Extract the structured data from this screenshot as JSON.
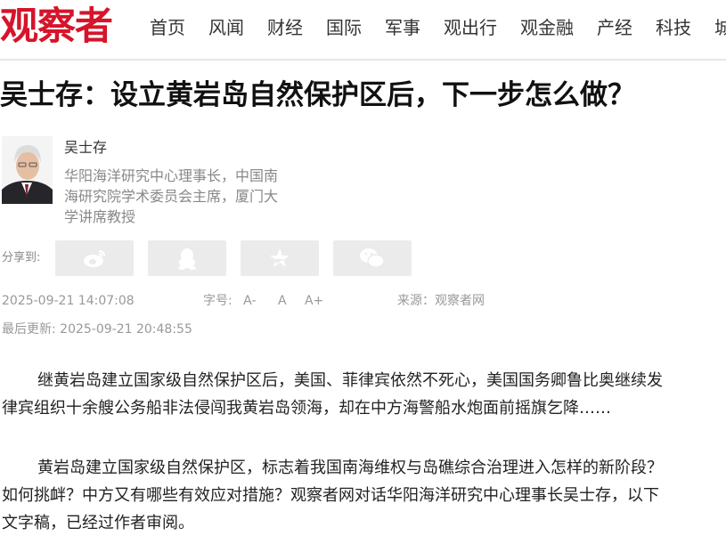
{
  "site": {
    "logo_text": "观察者"
  },
  "nav": [
    "首页",
    "风闻",
    "财经",
    "国际",
    "军事",
    "观出行",
    "观金融",
    "产经",
    "科技",
    "城"
  ],
  "article": {
    "title": "吴士存：设立黄岩岛自然保护区后，下一步怎么做？",
    "author": {
      "name": "吴士存",
      "bio": "华阳海洋研究中心理事长，中国南海研究院学术委员会主席，厦门大学讲席教授"
    },
    "share": {
      "label": "分享到:",
      "buttons": [
        "weibo-icon",
        "qq-icon",
        "qzone-star-icon",
        "wechat-icon"
      ]
    },
    "publish_time": "2025-09-21 14:07:08",
    "font_size": {
      "label": "字号:",
      "options": [
        "A-",
        "A",
        "A+"
      ]
    },
    "source": "来源：观察者网",
    "last_update": "最后更新: 2025-09-21 20:48:55",
    "paragraphs": [
      {
        "line1": "继黄岩岛建立国家级自然保护区后，美国、菲律宾依然不死心，美国国务卿鲁比奥继续发",
        "line2": "律宾组织十余艘公务船非法侵闯我黄岩岛领海，却在中方海警船水炮面前摇旗乞降……"
      },
      {
        "line1": "黄岩岛建立国家级自然保护区，标志着我国南海维权与岛礁综合治理进入怎样的新阶段？",
        "line2": "如何挑衅？中方又有哪些有效应对措施？观察者网对话华阳海洋研究中心理事长吴士存，以下",
        "line3": "文字稿，已经过作者审阅。"
      }
    ]
  },
  "colors": {
    "brand_red": "#d6142a",
    "meta_gray": "#999999",
    "share_bg": "#ebebeb"
  }
}
